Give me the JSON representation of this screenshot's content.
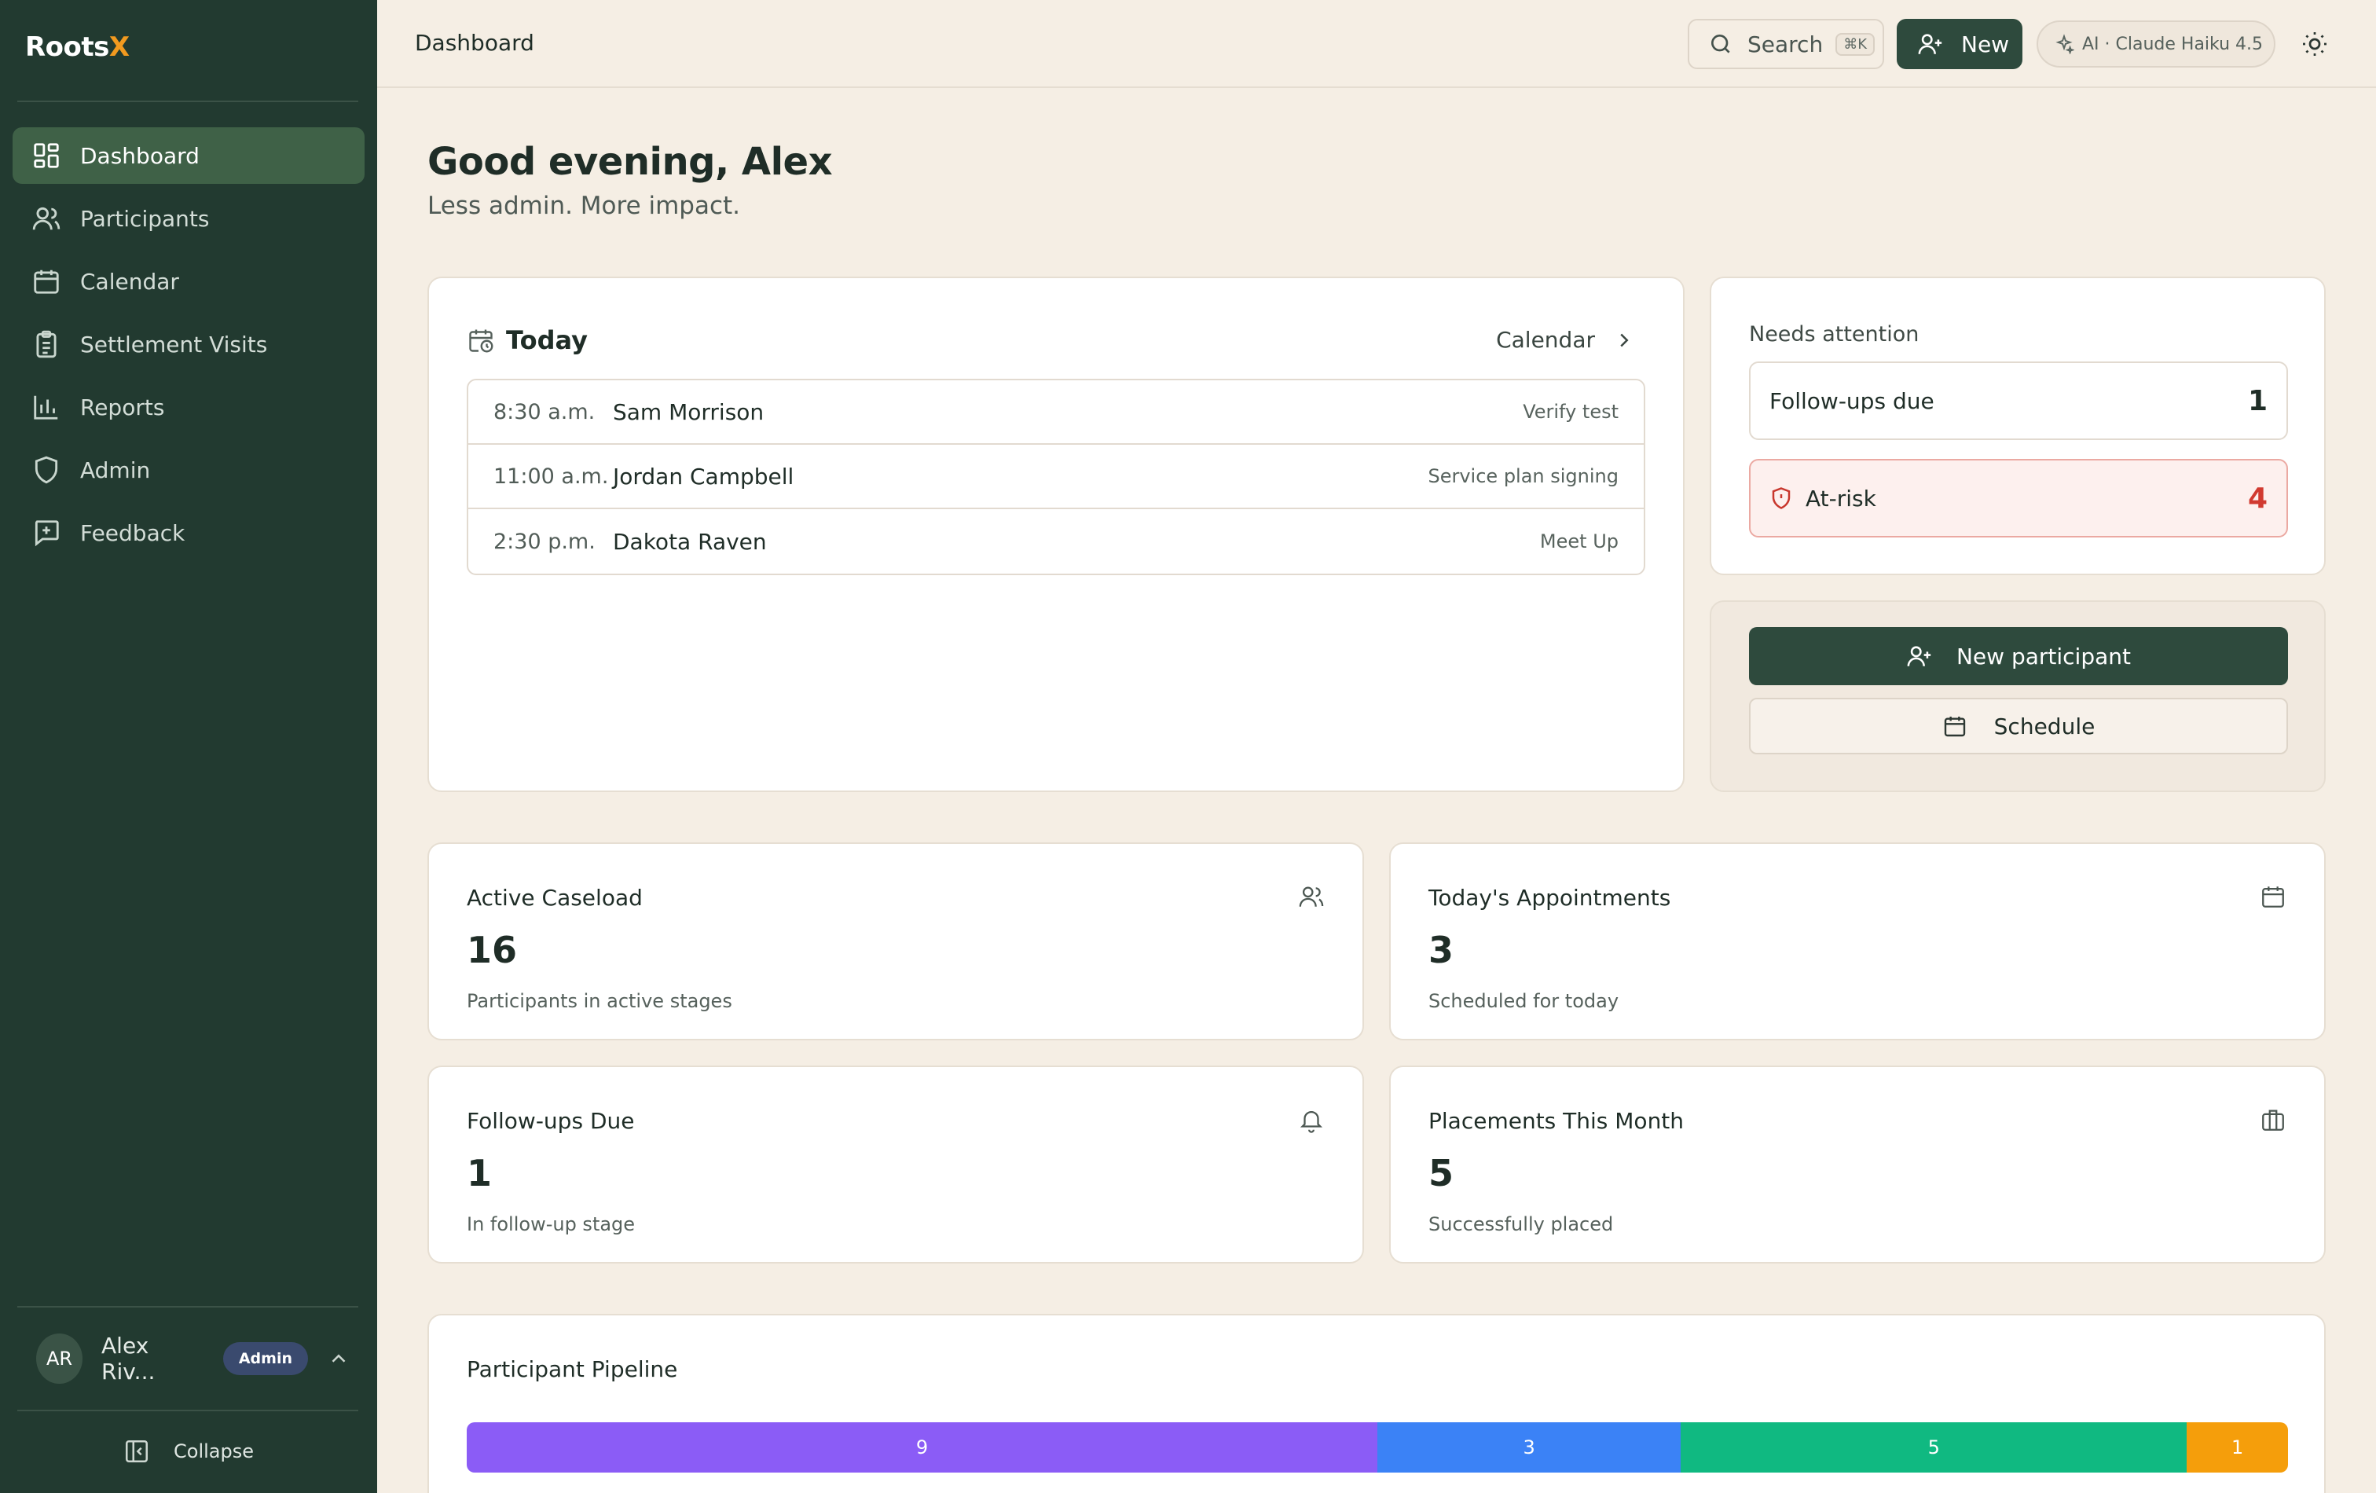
{
  "app": {
    "brand_main": "Roots",
    "brand_accent": "X"
  },
  "sidebar": {
    "items": [
      {
        "label": "Dashboard",
        "icon": "dashboard-icon",
        "active": true
      },
      {
        "label": "Participants",
        "icon": "users-icon",
        "active": false
      },
      {
        "label": "Calendar",
        "icon": "calendar-icon",
        "active": false
      },
      {
        "label": "Settlement Visits",
        "icon": "clipboard-icon",
        "active": false
      },
      {
        "label": "Reports",
        "icon": "bar-chart-icon",
        "active": false
      },
      {
        "label": "Admin",
        "icon": "shield-icon",
        "active": false
      },
      {
        "label": "Feedback",
        "icon": "message-plus-icon",
        "active": false
      }
    ],
    "user": {
      "initials": "AR",
      "name": "Alex Riv...",
      "role": "Admin"
    },
    "collapse_label": "Collapse"
  },
  "topbar": {
    "title": "Dashboard",
    "search_label": "Search",
    "search_shortcut": "⌘K",
    "new_label": "New",
    "ai_label": "AI · Claude Haiku 4.5"
  },
  "greeting": {
    "title": "Good evening, Alex",
    "subtitle": "Less admin. More impact."
  },
  "today": {
    "title": "Today",
    "calendar_link": "Calendar",
    "appointments": [
      {
        "time": "8:30 a.m.",
        "name": "Sam Morrison",
        "type": "Verify test"
      },
      {
        "time": "11:00 a.m.",
        "name": "Jordan Campbell",
        "type": "Service plan signing"
      },
      {
        "time": "2:30 p.m.",
        "name": "Dakota Raven",
        "type": "Meet Up"
      }
    ]
  },
  "attention": {
    "title": "Needs attention",
    "followups_label": "Follow-ups due",
    "followups_count": "1",
    "atrisk_label": "At-risk",
    "atrisk_count": "4"
  },
  "actions": {
    "new_participant": "New participant",
    "schedule": "Schedule"
  },
  "stats": [
    {
      "title": "Active Caseload",
      "value": "16",
      "desc": "Participants in active stages",
      "icon": "users-icon"
    },
    {
      "title": "Today's Appointments",
      "value": "3",
      "desc": "Scheduled for today",
      "icon": "calendar-grid-icon"
    },
    {
      "title": "Follow-ups Due",
      "value": "1",
      "desc": "In follow-up stage",
      "icon": "bell-icon"
    },
    {
      "title": "Placements This Month",
      "value": "5",
      "desc": "Successfully placed",
      "icon": "briefcase-icon"
    }
  ],
  "pipeline": {
    "title": "Participant Pipeline",
    "segments": [
      {
        "value": 9,
        "label": "9",
        "color": "#8b5cf6"
      },
      {
        "value": 3,
        "label": "3",
        "color": "#3b82f6"
      },
      {
        "value": 5,
        "label": "5",
        "color": "#10b981"
      },
      {
        "value": 1,
        "label": "1",
        "color": "#f59e0b"
      }
    ]
  },
  "colors": {
    "sidebar_bg": "#223a30",
    "active_nav": "#3f6147",
    "primary_button": "#2e4a3d",
    "page_bg": "#f5eee4",
    "brand_accent": "#f29a1f",
    "risk_red": "#d13a30"
  }
}
